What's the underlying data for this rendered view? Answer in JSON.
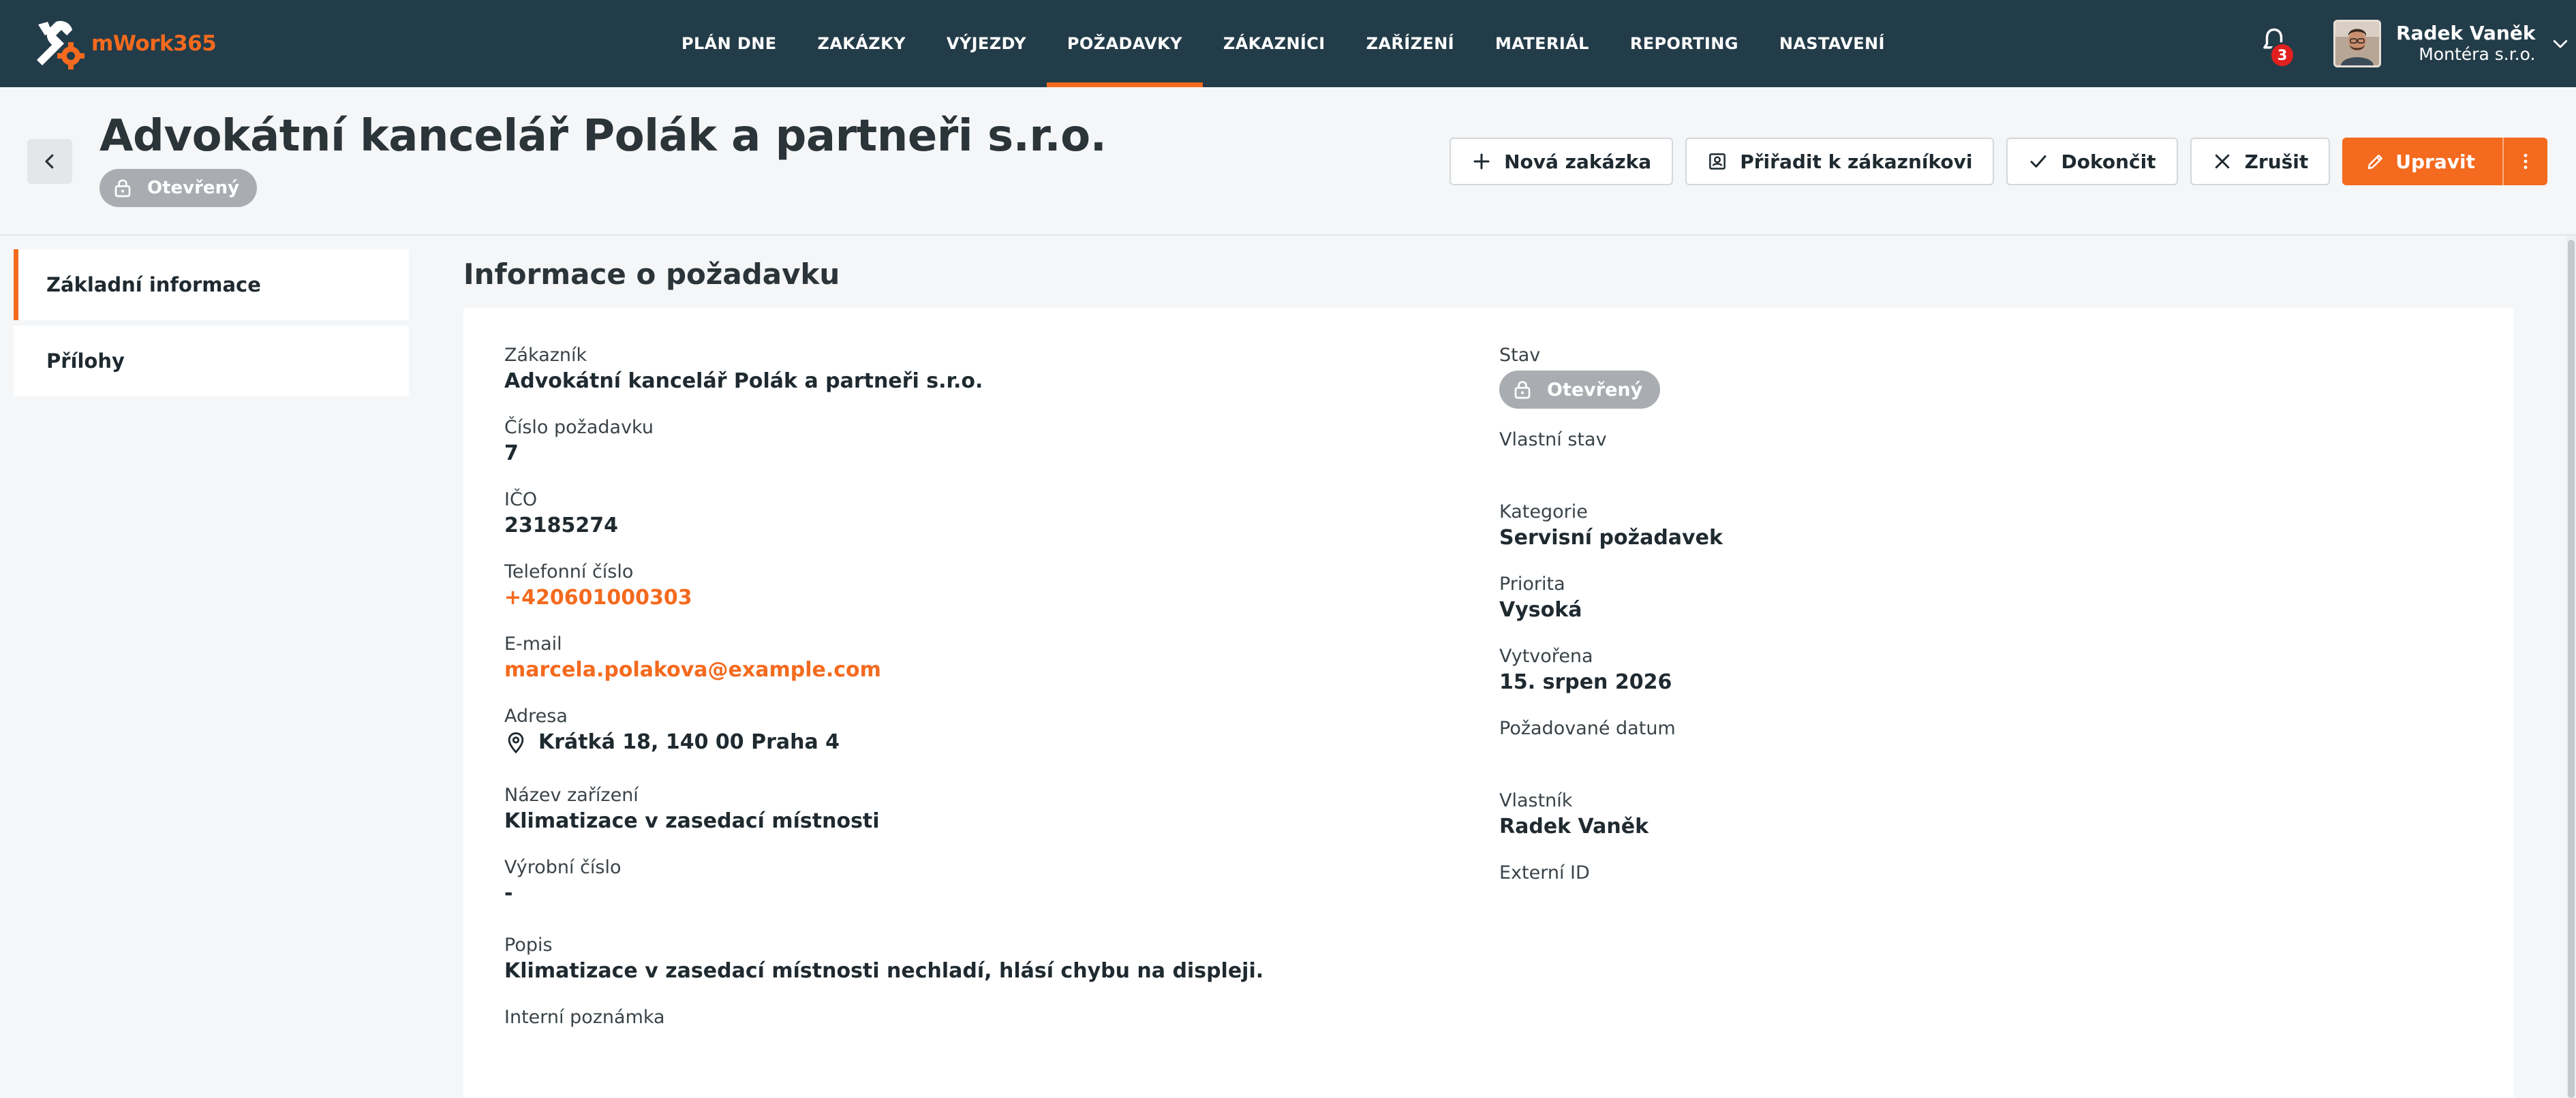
{
  "app": {
    "name": "mWork365"
  },
  "nav": {
    "items": [
      {
        "label": "PLÁN DNE",
        "active": false
      },
      {
        "label": "ZAKÁZKY",
        "active": false
      },
      {
        "label": "VÝJEZDY",
        "active": false
      },
      {
        "label": "POŽADAVKY",
        "active": true
      },
      {
        "label": "ZÁKAZNÍCI",
        "active": false
      },
      {
        "label": "ZAŘÍZENÍ",
        "active": false
      },
      {
        "label": "MATERIÁL",
        "active": false
      },
      {
        "label": "REPORTING",
        "active": false
      },
      {
        "label": "NASTAVENÍ",
        "active": false
      }
    ],
    "notifications": "3",
    "user": {
      "name": "Radek Vaněk",
      "company": "Montéra s.r.o."
    }
  },
  "header": {
    "title": "Advokátní kancelář Polák a partneři s.r.o.",
    "status": "Otevřený",
    "actions": {
      "new_order": "Nová zakázka",
      "assign_customer": "Přiřadit k zákazníkovi",
      "complete": "Dokončit",
      "cancel": "Zrušit",
      "edit": "Upravit"
    }
  },
  "sidebar": {
    "items": [
      {
        "label": "Základní informace",
        "active": true
      },
      {
        "label": "Přílohy",
        "active": false
      }
    ]
  },
  "section": {
    "title": "Informace o požadavku"
  },
  "left": {
    "customer": {
      "label": "Zákazník",
      "value": "Advokátní kancelář Polák a partneři s.r.o."
    },
    "request_no": {
      "label": "Číslo požadavku",
      "value": "7"
    },
    "ico": {
      "label": "IČO",
      "value": "23185274"
    },
    "phone": {
      "label": "Telefonní číslo",
      "value": "+420601000303"
    },
    "email": {
      "label": "E-mail",
      "value": "marcela.polakova@example.com"
    },
    "address": {
      "label": "Adresa",
      "value": "Krátká 18, 140 00 Praha 4"
    },
    "device_name": {
      "label": "Název zařízení",
      "value": "Klimatizace v zasedací místnosti"
    },
    "serial": {
      "label": "Výrobní číslo",
      "value": "-"
    },
    "description": {
      "label": "Popis",
      "value": "Klimatizace v zasedací místnosti nechladí, hlásí chybu na displeji."
    },
    "internal_note": {
      "label": "Interní poznámka",
      "value": ""
    }
  },
  "right": {
    "state": {
      "label": "Stav",
      "value": "Otevřený"
    },
    "custom_state": {
      "label": "Vlastní stav",
      "value": ""
    },
    "category": {
      "label": "Kategorie",
      "value": "Servisní požadavek"
    },
    "priority": {
      "label": "Priorita",
      "value": "Vysoká"
    },
    "created": {
      "label": "Vytvořena",
      "value": "15. srpen 2026"
    },
    "requested_date": {
      "label": "Požadované datum",
      "value": ""
    },
    "owner": {
      "label": "Vlastník",
      "value": "Radek Vaněk"
    },
    "external_id": {
      "label": "Externí ID",
      "value": ""
    }
  },
  "colors": {
    "navbar": "#233c49",
    "accent": "#f46a1e",
    "status_grey": "#a9adb1",
    "badge": "#e0201f"
  },
  "icons": [
    "logo-icon",
    "bell-icon",
    "chevron-down-icon",
    "chevron-left-icon",
    "lock-icon",
    "plus-icon",
    "contact-card-icon",
    "check-icon",
    "close-icon",
    "pencil-icon",
    "more-vertical-icon",
    "location-pin-icon"
  ]
}
